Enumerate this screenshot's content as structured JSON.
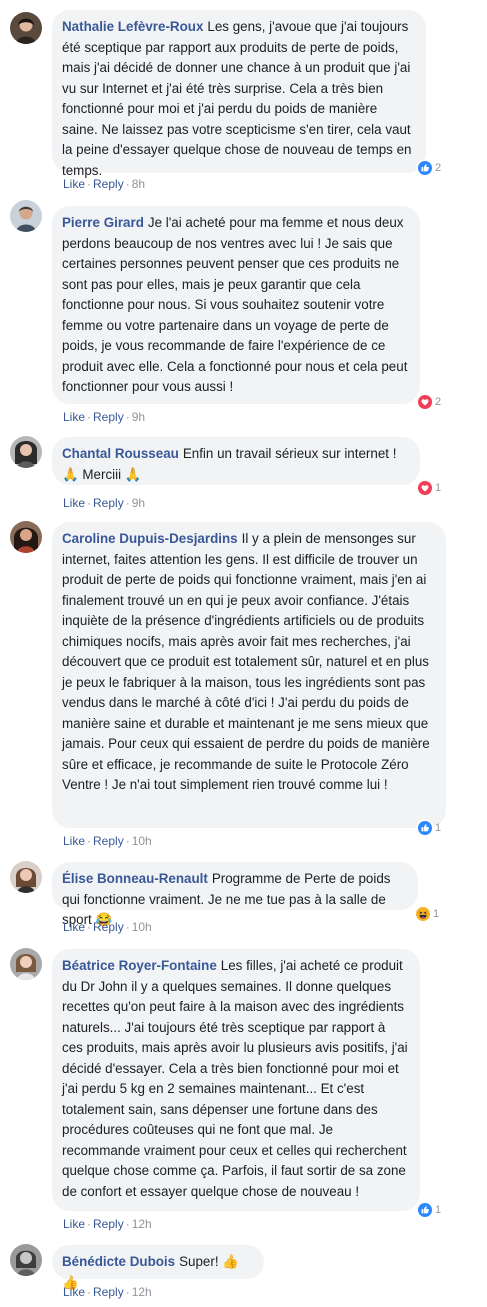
{
  "actions": {
    "like": "Like",
    "reply": "Reply",
    "separator": "·"
  },
  "colors": {
    "link": "#385898",
    "bubble": "#f2f3f5",
    "meta": "#90949c",
    "like_blue": "#2d88ff",
    "love_red": "#f33e58",
    "haha_yellow": "#f7b125"
  },
  "comments": [
    {
      "author": "Nathalie Lefèvre-Roux",
      "text": "Les gens, j'avoue que j'ai toujours été sceptique par rapport aux produits de perte de poids, mais j'ai décidé de donner une chance à un produit que j'ai vu sur Internet et j'ai été très surprise. Cela a très bien fonctionné pour moi et j'ai perdu du poids de manière saine. Ne laissez pas votre scepticisme s'en tirer, cela vaut la peine d'essayer quelque chose de nouveau de temps en temps.",
      "time": "8h",
      "reaction": {
        "icon": "like-icon",
        "count": "2"
      }
    },
    {
      "author": "Pierre Girard",
      "text": "Je l'ai acheté pour ma femme et nous deux perdons beaucoup de nos ventres avec lui ! Je sais que certaines personnes peuvent penser que ces produits ne sont pas pour elles, mais je peux garantir que cela fonctionne pour nous. Si vous souhaitez soutenir votre femme ou votre partenaire dans un voyage de perte de poids, je vous recommande de faire l'expérience de ce produit avec elle. Cela a fonctionné pour nous et cela peut fonctionner pour vous aussi !",
      "time": "9h",
      "reaction": {
        "icon": "love-icon",
        "count": "2"
      }
    },
    {
      "author": "Chantal Rousseau",
      "text": "Enfin un travail sérieux sur internet ! 🙏 Merciii 🙏",
      "time": "9h",
      "reaction": {
        "icon": "love-icon",
        "count": "1"
      }
    },
    {
      "author": "Caroline Dupuis-Desjardins",
      "text": "Il y a plein de mensonges sur internet, faites attention les gens. Il est difficile de trouver un produit de perte de poids qui fonctionne vraiment, mais j'en ai finalement trouvé un en qui je peux avoir confiance. J'étais inquiète de la présence d'ingrédients artificiels ou de produits chimiques nocifs, mais après avoir fait mes recherches, j'ai découvert que ce produit est totalement sûr, naturel et en plus je peux le fabriquer à la maison, tous les ingrédients sont pas vendus dans le marché à côté d'ici ! J'ai perdu du poids de manière saine et durable et maintenant je me sens mieux que jamais. Pour ceux qui essaient de perdre du poids de manière sûre et efficace, je recommande de suite le Protocole Zéro Ventre ! Je n'ai tout simplement rien trouvé comme lui !",
      "time": "10h",
      "reaction": {
        "icon": "like-icon",
        "count": "1"
      }
    },
    {
      "author": "Élise Bonneau-Renault",
      "text": "Programme de Perte de poids qui fonctionne vraiment. Je ne me tue pas à la salle de sport 😂",
      "time": "10h",
      "reaction": {
        "icon": "haha-icon",
        "count": "1"
      }
    },
    {
      "author": "Béatrice Royer-Fontaine",
      "text": "Les filles, j'ai acheté ce produit du Dr John il y a quelques semaines. Il donne quelques recettes qu'on peut faire à la maison avec des ingrédients naturels... J'ai toujours été très sceptique par rapport à ces produits, mais après avoir lu plusieurs avis positifs, j'ai décidé d'essayer. Cela a très bien fonctionné pour moi et j'ai perdu 5 kg en 2 semaines maintenant... Et c'est totalement sain, sans dépenser une fortune dans des procédures coûteuses qui ne font que mal. Je recommande vraiment pour ceux et celles qui recherchent quelque chose comme ça. Parfois, il faut sortir de sa zone de confort et essayer quelque chose de nouveau !",
      "time": "12h",
      "reaction": {
        "icon": "like-icon",
        "count": "1"
      }
    },
    {
      "author": "Bénédicte Dubois",
      "text": "Super! 👍 👍",
      "time": "12h",
      "reaction": null
    }
  ]
}
